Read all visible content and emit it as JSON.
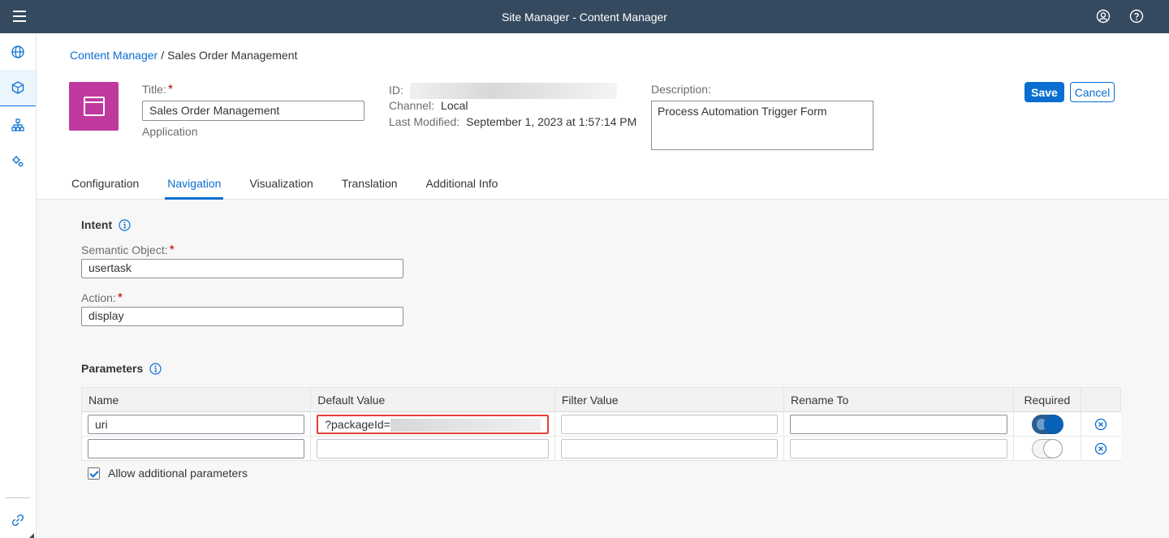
{
  "shell": {
    "title": "Site Manager - Content Manager"
  },
  "breadcrumb": {
    "root": "Content Manager",
    "separator": "/",
    "current": "Sales Order Management"
  },
  "header": {
    "title_label": "Title:",
    "title_value": "Sales Order Management",
    "type_label": "Application",
    "id_label": "ID:",
    "channel_label": "Channel:",
    "channel_value": "Local",
    "modified_label": "Last Modified:",
    "modified_value": "September 1, 2023 at 1:57:14 PM",
    "description_label": "Description:",
    "description_value": "Process Automation Trigger Form",
    "save_label": "Save",
    "cancel_label": "Cancel",
    "required_mark": "*"
  },
  "tabs": [
    {
      "label": "Configuration"
    },
    {
      "label": "Navigation"
    },
    {
      "label": "Visualization"
    },
    {
      "label": "Translation"
    },
    {
      "label": "Additional Info"
    }
  ],
  "intent": {
    "title": "Intent",
    "semantic_label": "Semantic Object:",
    "semantic_value": "usertask",
    "action_label": "Action:",
    "action_value": "display"
  },
  "parameters": {
    "title": "Parameters",
    "columns": [
      "Name",
      "Default Value",
      "Filter Value",
      "Rename To",
      "Required"
    ],
    "rows": [
      {
        "name": "uri",
        "default": "?packageId=",
        "filter": "",
        "rename": "",
        "required": true
      },
      {
        "name": "",
        "default": "",
        "filter": "",
        "rename": "",
        "required": false
      }
    ],
    "allow_label": "Allow additional parameters"
  },
  "colors": {
    "shell": "#354a5f",
    "accent": "#0a6ed1",
    "app_icon": "#c0399f",
    "highlight": "#e3403a"
  }
}
